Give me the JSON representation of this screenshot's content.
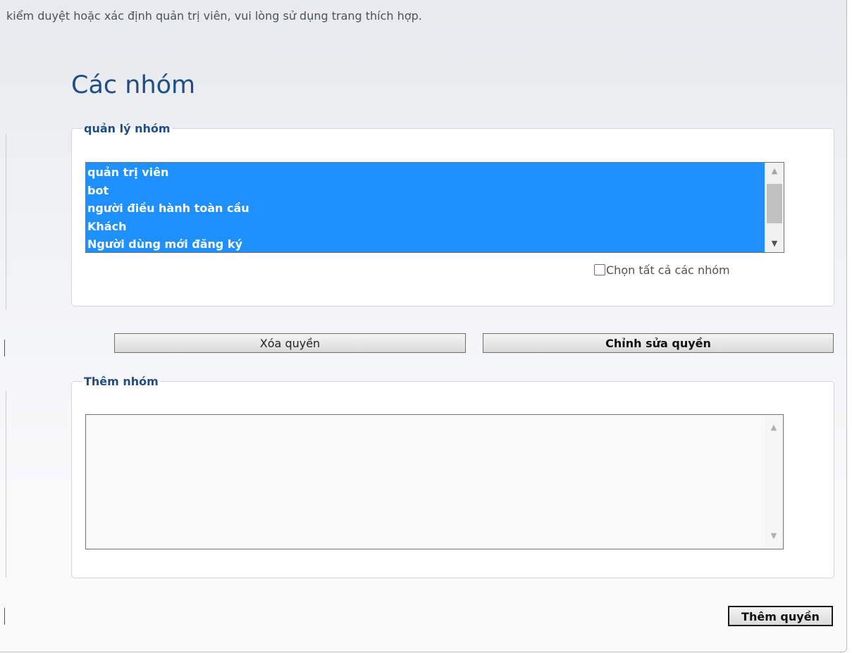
{
  "intro_text": "kiểm duyệt hoặc xác định quản trị viên, vui lòng sử dụng trang thích hợp.",
  "page_title": "Các nhóm",
  "manage_groups": {
    "legend": "quản lý nhóm",
    "options": [
      "quản trị viên",
      "bot",
      "người điều hành toàn cầu",
      "Khách",
      "Người dùng mới đăng ký"
    ],
    "select_all_label": "Chọn tất cả các nhóm",
    "select_all_checked": false
  },
  "actions": {
    "remove_label": "Xóa quyền",
    "edit_label": "Chỉnh sửa quyền"
  },
  "add_groups": {
    "legend": "Thêm nhóm",
    "value": ""
  },
  "add_button_label": "Thêm quyền",
  "icons": {
    "scroll_up": "triangle-up",
    "scroll_down": "triangle-down",
    "checkbox": "checkbox-unchecked"
  },
  "colors": {
    "heading": "#1f4e86",
    "selection": "#1e90ff"
  }
}
